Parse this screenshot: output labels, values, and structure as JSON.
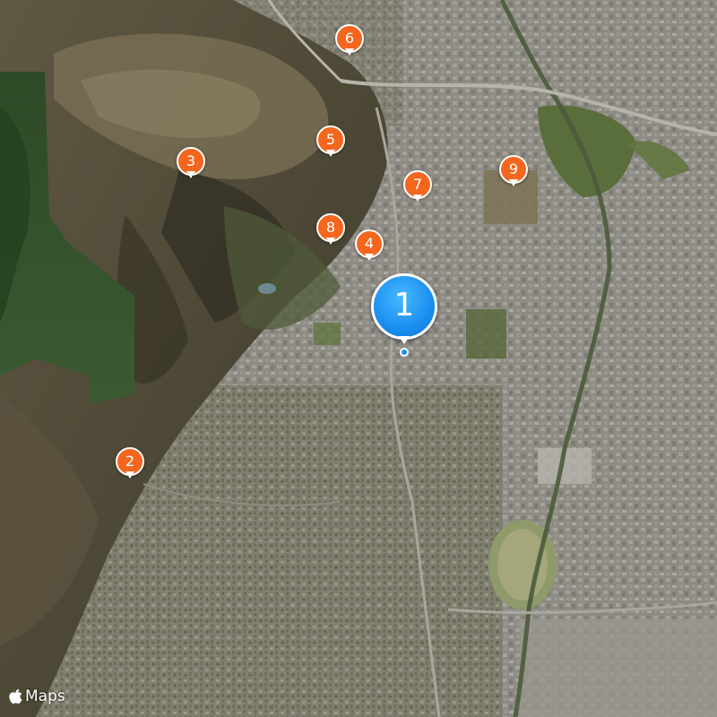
{
  "map": {
    "colors": {
      "pin_orange": "#f4661d",
      "pin_blue": "#1a8ff0",
      "pin_border": "#ffffff"
    },
    "selected_pin": {
      "label": "1"
    },
    "pins": [
      {
        "label": "2"
      },
      {
        "label": "3"
      },
      {
        "label": "4"
      },
      {
        "label": "5"
      },
      {
        "label": "6"
      },
      {
        "label": "7"
      },
      {
        "label": "8"
      },
      {
        "label": "9"
      }
    ],
    "attribution": {
      "icon": "apple-logo-icon",
      "text": "Maps"
    }
  }
}
